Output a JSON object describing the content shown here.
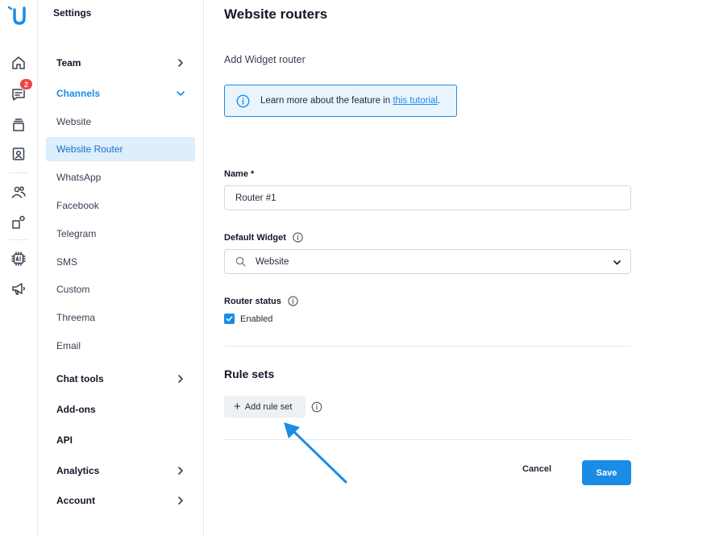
{
  "sidebar": {
    "title": "Settings",
    "items": [
      {
        "label": "Team"
      },
      {
        "label": "Channels"
      },
      {
        "label": "Website"
      },
      {
        "label": "Website Router"
      },
      {
        "label": "WhatsApp"
      },
      {
        "label": "Facebook"
      },
      {
        "label": "Telegram"
      },
      {
        "label": "SMS"
      },
      {
        "label": "Custom"
      },
      {
        "label": "Threema"
      },
      {
        "label": "Email"
      },
      {
        "label": "Chat tools"
      },
      {
        "label": "Add-ons"
      },
      {
        "label": "API"
      },
      {
        "label": "Analytics"
      },
      {
        "label": "Account"
      }
    ],
    "active_item": "Website Router"
  },
  "rail": {
    "notification_count": "2",
    "icons": [
      "home-icon",
      "chat-icon",
      "inbox-stack-icon",
      "contacts-icon",
      "team-icon",
      "integrations-icon",
      "ai-chip-icon",
      "megaphone-icon"
    ]
  },
  "main": {
    "title": "Website routers",
    "subtitle": "Add Widget router",
    "info": {
      "text": "Learn more about the feature in ",
      "link": "this tutorial",
      "suffix": "."
    },
    "name_label": "Name *",
    "name_value": "Router #1",
    "widget_label": "Default Widget",
    "widget_value": "Website",
    "status_label": "Router status",
    "status_checkbox": "Enabled",
    "rule_sets_title": "Rule sets",
    "add_rule_set": "Add rule set",
    "cancel": "Cancel",
    "save": "Save"
  },
  "colors": {
    "accent": "#1a8ce6",
    "active_bg": "#ddeefc",
    "badge": "#ef4444"
  }
}
